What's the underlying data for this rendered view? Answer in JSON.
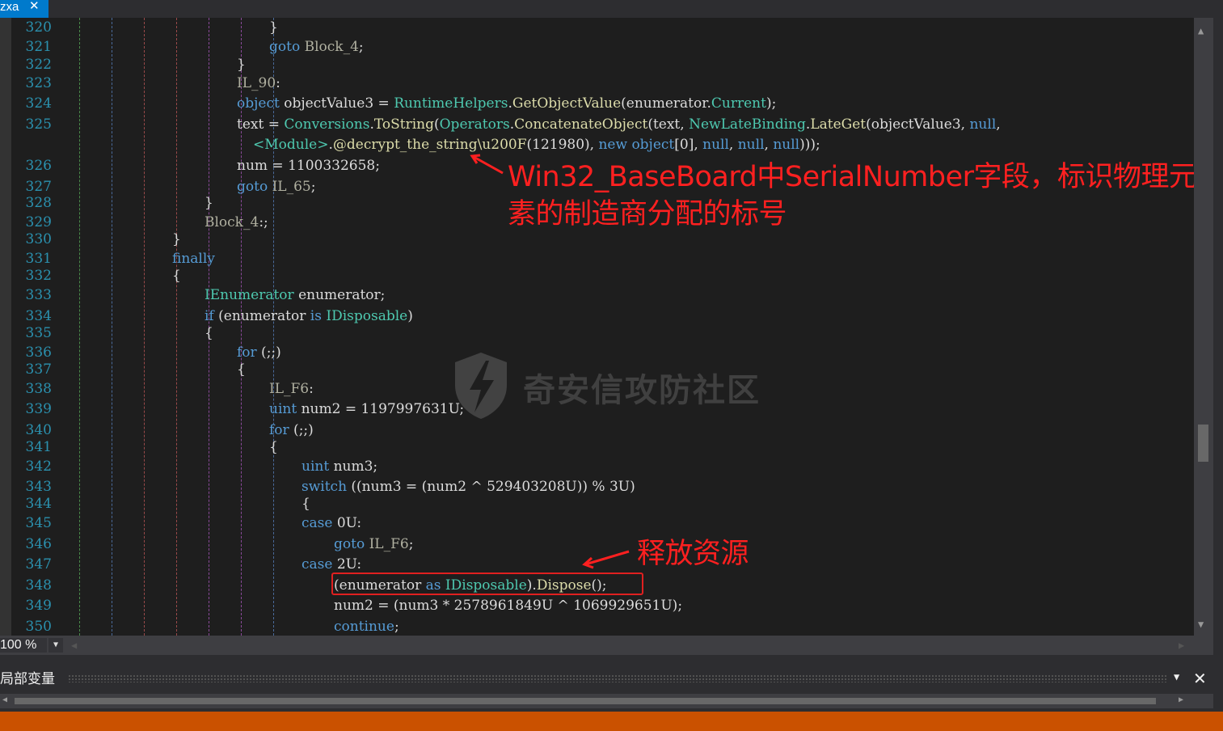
{
  "tab": {
    "title": "zxa",
    "close_icon": "close-icon"
  },
  "lines": [
    {
      "n": "320",
      "parts": [
        [
          "tx",
          "}"
        ]
      ]
    },
    {
      "n": "321",
      "parts": [
        [
          "kw",
          "goto"
        ],
        [
          "tx",
          " "
        ],
        [
          "lbl",
          "Block_4"
        ],
        [
          "tx",
          ";"
        ]
      ]
    },
    {
      "n": "322",
      "parts": [
        [
          "tx",
          "}"
        ]
      ]
    },
    {
      "n": "323",
      "parts": [
        [
          "lbl",
          "IL_90"
        ],
        [
          "tx",
          ":"
        ]
      ]
    },
    {
      "n": "324",
      "parts": [
        [
          "kw",
          "object"
        ],
        [
          "tx",
          " objectValue3 = "
        ],
        [
          "ty",
          "RuntimeHelpers"
        ],
        [
          "tx",
          "."
        ],
        [
          "mt",
          "GetObjectValue"
        ],
        [
          "tx",
          "(enumerator."
        ],
        [
          "ty",
          "Current"
        ],
        [
          "tx",
          ");"
        ]
      ]
    },
    {
      "n": "325",
      "parts": [
        [
          "tx",
          "text = "
        ],
        [
          "ty",
          "Conversions"
        ],
        [
          "tx",
          "."
        ],
        [
          "mt",
          "ToString"
        ],
        [
          "tx",
          "("
        ],
        [
          "ty",
          "Operators"
        ],
        [
          "tx",
          "."
        ],
        [
          "mt",
          "ConcatenateObject"
        ],
        [
          "tx",
          "(text, "
        ],
        [
          "ty",
          "NewLateBinding"
        ],
        [
          "tx",
          "."
        ],
        [
          "mt",
          "LateGet"
        ],
        [
          "tx",
          "(objectValue3, "
        ],
        [
          "kw",
          "null"
        ],
        [
          "tx",
          ","
        ]
      ]
    },
    {
      "n": "",
      "parts": [
        [
          "ty",
          "<Module>"
        ],
        [
          "tx",
          "."
        ],
        [
          "mt",
          "@decrypt_the_string\\u200F"
        ],
        [
          "tx",
          "(121980), "
        ],
        [
          "kw",
          "new"
        ],
        [
          "tx",
          " "
        ],
        [
          "kw",
          "object"
        ],
        [
          "tx",
          "[0], "
        ],
        [
          "kw",
          "null"
        ],
        [
          "tx",
          ", "
        ],
        [
          "kw",
          "null"
        ],
        [
          "tx",
          ", "
        ],
        [
          "kw",
          "null"
        ],
        [
          "tx",
          ")));"
        ]
      ]
    },
    {
      "n": "326",
      "parts": [
        [
          "tx",
          "num = 1100332658;"
        ]
      ]
    },
    {
      "n": "327",
      "parts": [
        [
          "kw",
          "goto"
        ],
        [
          "tx",
          " "
        ],
        [
          "lbl",
          "IL_65"
        ],
        [
          "tx",
          ";"
        ]
      ]
    },
    {
      "n": "328",
      "parts": [
        [
          "tx",
          "}"
        ]
      ]
    },
    {
      "n": "329",
      "parts": [
        [
          "lbl",
          "Block_4"
        ],
        [
          "tx",
          ":;"
        ]
      ]
    },
    {
      "n": "330",
      "parts": [
        [
          "tx",
          "}"
        ]
      ]
    },
    {
      "n": "331",
      "parts": [
        [
          "kw",
          "finally"
        ]
      ]
    },
    {
      "n": "332",
      "parts": [
        [
          "tx",
          "{"
        ]
      ]
    },
    {
      "n": "333",
      "parts": [
        [
          "ty",
          "IEnumerator"
        ],
        [
          "tx",
          " enumerator;"
        ]
      ]
    },
    {
      "n": "334",
      "parts": [
        [
          "kw",
          "if"
        ],
        [
          "tx",
          " (enumerator "
        ],
        [
          "kw",
          "is"
        ],
        [
          "tx",
          " "
        ],
        [
          "ty",
          "IDisposable"
        ],
        [
          "tx",
          ")"
        ]
      ]
    },
    {
      "n": "335",
      "parts": [
        [
          "tx",
          "{"
        ]
      ]
    },
    {
      "n": "336",
      "parts": [
        [
          "kw",
          "for"
        ],
        [
          "tx",
          " (;;)"
        ]
      ]
    },
    {
      "n": "337",
      "parts": [
        [
          "tx",
          "{"
        ]
      ]
    },
    {
      "n": "338",
      "parts": [
        [
          "lbl",
          "IL_F6"
        ],
        [
          "tx",
          ":"
        ]
      ]
    },
    {
      "n": "339",
      "parts": [
        [
          "kw",
          "uint"
        ],
        [
          "tx",
          " num2 = 1197997631U;"
        ]
      ]
    },
    {
      "n": "340",
      "parts": [
        [
          "kw",
          "for"
        ],
        [
          "tx",
          " (;;)"
        ]
      ]
    },
    {
      "n": "341",
      "parts": [
        [
          "tx",
          "{"
        ]
      ]
    },
    {
      "n": "342",
      "parts": [
        [
          "kw",
          "uint"
        ],
        [
          "tx",
          " num3;"
        ]
      ]
    },
    {
      "n": "343",
      "parts": [
        [
          "kw",
          "switch"
        ],
        [
          "tx",
          " ((num3 = (num2 ^ 529403208U)) % 3U)"
        ]
      ]
    },
    {
      "n": "344",
      "parts": [
        [
          "tx",
          "{"
        ]
      ]
    },
    {
      "n": "345",
      "parts": [
        [
          "kw",
          "case"
        ],
        [
          "tx",
          " 0U:"
        ]
      ]
    },
    {
      "n": "346",
      "parts": [
        [
          "kw",
          "goto"
        ],
        [
          "tx",
          " "
        ],
        [
          "lbl",
          "IL_F6"
        ],
        [
          "tx",
          ";"
        ]
      ]
    },
    {
      "n": "347",
      "parts": [
        [
          "kw",
          "case"
        ],
        [
          "tx",
          " 2U:"
        ]
      ]
    },
    {
      "n": "348",
      "parts": [
        [
          "tx",
          "(enumerator "
        ],
        [
          "kw",
          "as"
        ],
        [
          "tx",
          " "
        ],
        [
          "ty",
          "IDisposable"
        ],
        [
          "tx",
          ")."
        ],
        [
          "mt",
          "Dispose"
        ],
        [
          "tx",
          "();"
        ]
      ]
    },
    {
      "n": "349",
      "parts": [
        [
          "tx",
          "num2 = (num3 * 2578961849U ^ 1069929651U);"
        ]
      ]
    },
    {
      "n": "350",
      "parts": [
        [
          "kw",
          "continue"
        ],
        [
          "tx",
          ";"
        ]
      ]
    }
  ],
  "annotations": {
    "serial": "Win32_BaseBoard中SerialNumber字段，标识物理元素的制造商分配的标号",
    "dispose": "释放资源"
  },
  "watermark": "奇安信攻防社区",
  "zoom": "100 %",
  "panel": {
    "title": "局部变量"
  },
  "colors": {
    "keyword": "#569cd6",
    "type": "#4ec9b0",
    "method": "#dcdcaa",
    "line_number": "#2b91af",
    "annotation": "#ff2020",
    "status_bar": "#ca5100",
    "tab_active": "#007acc"
  }
}
